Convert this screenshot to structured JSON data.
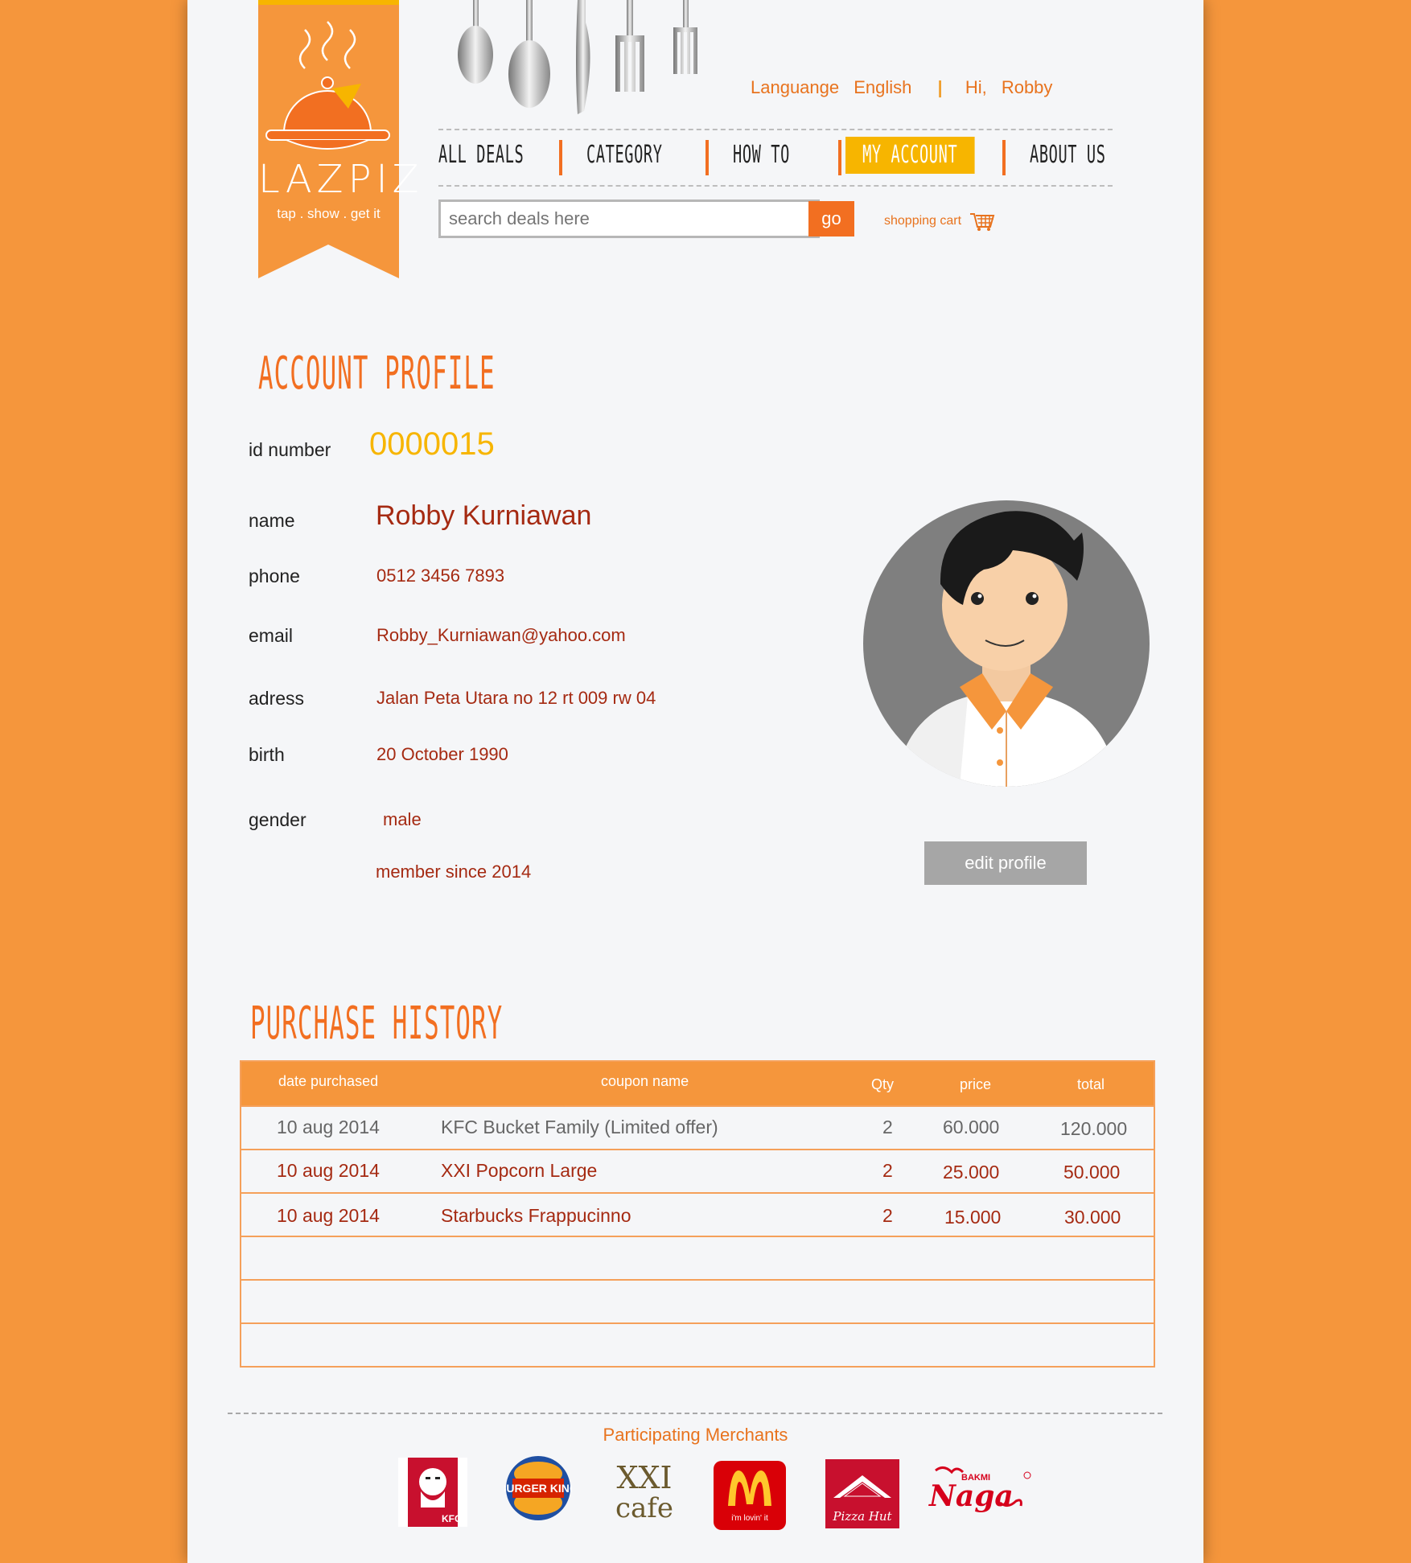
{
  "brand": {
    "name": "LAZPIZ",
    "tagline": "tap . show . get it"
  },
  "header": {
    "language_label": "Languange",
    "language_value": "English",
    "greeting": "Hi,",
    "user": "Robby"
  },
  "nav": {
    "items": [
      {
        "label": "ALL DEALS"
      },
      {
        "label": "CATEGORY"
      },
      {
        "label": "HOW TO"
      },
      {
        "label": "MY ACCOUNT"
      },
      {
        "label": "ABOUT US"
      }
    ],
    "active": "MY ACCOUNT"
  },
  "search": {
    "placeholder": "search deals here",
    "button": "go"
  },
  "cart": {
    "label": "shopping cart"
  },
  "profile": {
    "title": "ACCOUNT PROFILE",
    "id_label": "id number",
    "id_value": "0000015",
    "name_label": "name",
    "name_value": "Robby Kurniawan",
    "phone_label": "phone",
    "phone_value": "0512 3456 7893",
    "email_label": "email",
    "email_value": "Robby_Kurniawan@yahoo.com",
    "address_label": "adress",
    "address_value": "Jalan Peta Utara no 12 rt 009 rw 04",
    "birth_label": "birth",
    "birth_value": "20 October 1990",
    "gender_label": "gender",
    "gender_value": "male",
    "member_since": "member since 2014",
    "edit_button": "edit profile"
  },
  "history": {
    "title": "PURCHASE HISTORY",
    "headers": {
      "date": "date purchased",
      "coupon": "coupon name",
      "qty": "Qty",
      "price": "price",
      "total": "total"
    },
    "rows": [
      {
        "date": "10 aug 2014",
        "coupon": "KFC Bucket Family (Limited offer)",
        "qty": "2",
        "price": "60.000",
        "total": "120.000"
      },
      {
        "date": "10 aug 2014",
        "coupon": "XXI Popcorn Large",
        "qty": "2",
        "price": "25.000",
        "total": "50.000"
      },
      {
        "date": "10 aug 2014",
        "coupon": "Starbucks Frappucinno",
        "qty": "2",
        "price": "15.000",
        "total": "30.000"
      }
    ]
  },
  "footer": {
    "title": "Participating Merchants",
    "merchants": {
      "kfc": "KFC",
      "burger_king": "BURGER KING",
      "xxi_top": "XXI",
      "xxi_bottom": "cafe",
      "mcd_tagline": "i'm lovin' it",
      "pizza_hut": "Pizza Hut",
      "bakmi_small": "BAKMI",
      "bakmi_name": "Naga"
    }
  },
  "colors": {
    "accent": "#f26f21",
    "yellow": "#f7b500",
    "dark_red": "#a52a12",
    "background": "#f5963c"
  }
}
